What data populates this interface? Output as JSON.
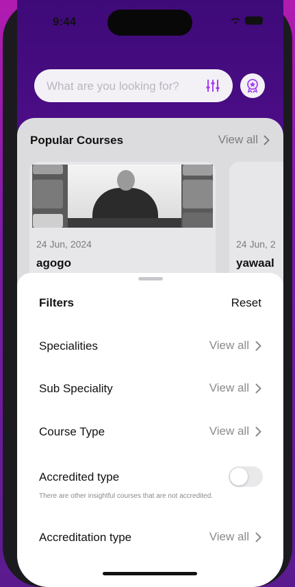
{
  "status_bar": {
    "time": "9:44"
  },
  "search": {
    "placeholder": "What are you looking for?"
  },
  "popular": {
    "title": "Popular Courses",
    "view_all": "View all",
    "cards": [
      {
        "date": "24 Jun, 2024",
        "title": "agogo"
      },
      {
        "date": "24 Jun, 2",
        "title": "yawaal"
      }
    ]
  },
  "filters": {
    "title": "Filters",
    "reset": "Reset",
    "rows": [
      {
        "label": "Specialities",
        "action": "View all"
      },
      {
        "label": "Sub Speciality",
        "action": "View all"
      },
      {
        "label": "Course Type",
        "action": "View all"
      }
    ],
    "accredited": {
      "label": "Accredited type",
      "toggle_on": false,
      "note": "There are other insightful courses that are not accredited."
    },
    "accreditation": {
      "label": "Accreditation type",
      "action": "View all"
    }
  },
  "colors": {
    "accent": "#8a2be2",
    "header_bg": "#4b0c86"
  }
}
